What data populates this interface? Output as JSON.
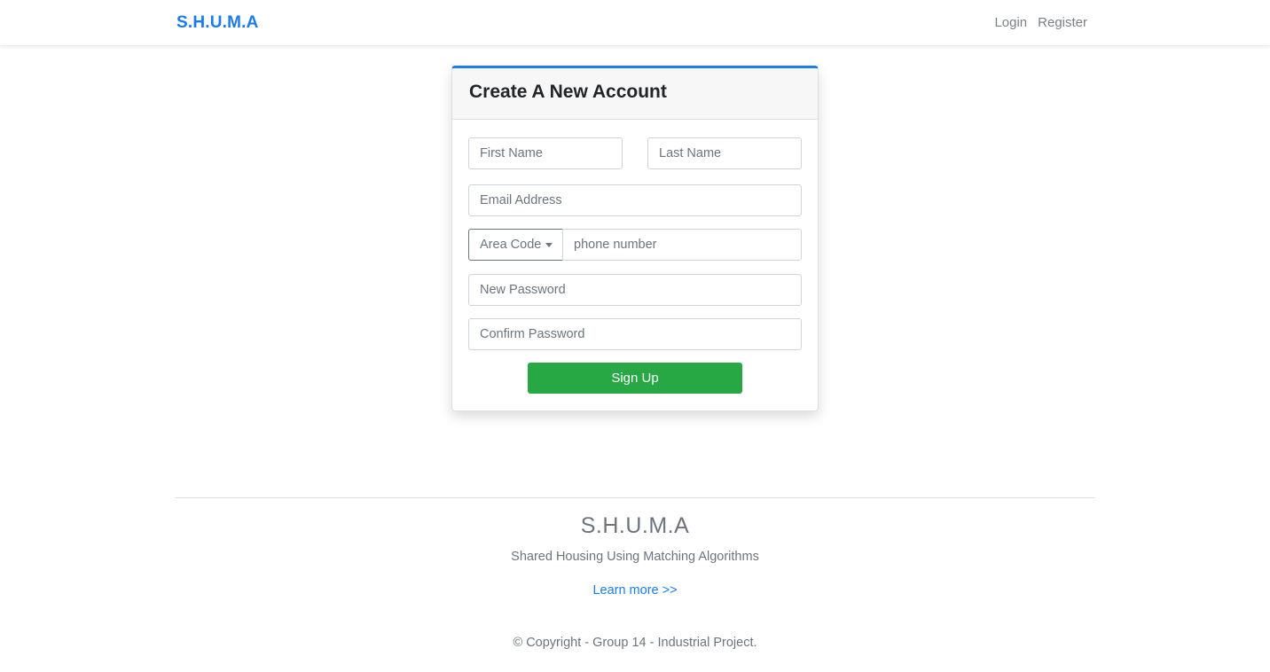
{
  "navbar": {
    "brand": "S.H.U.M.A",
    "links": [
      {
        "label": "Login"
      },
      {
        "label": "Register"
      }
    ]
  },
  "form": {
    "title": "Create A New Account",
    "first_name_placeholder": "First Name",
    "last_name_placeholder": "Last Name",
    "email_placeholder": "Email Address",
    "area_code_label": "Area Code",
    "phone_placeholder": "phone number",
    "new_password_placeholder": "New Password",
    "confirm_password_placeholder": "Confirm Password",
    "submit_label": "Sign Up"
  },
  "footer": {
    "title": "S.H.U.M.A",
    "subtitle": "Shared Housing Using Matching Algorithms",
    "learn_more": "Learn more >>",
    "copyright": "© Copyright - Group 14 - Industrial Project."
  },
  "colors": {
    "brand": "#1a7cf0",
    "success": "#28a745"
  }
}
